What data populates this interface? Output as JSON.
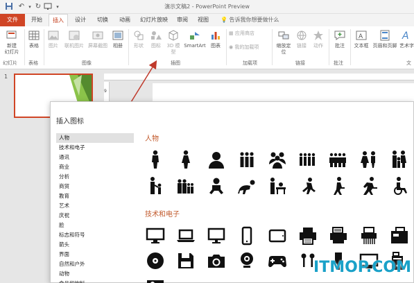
{
  "window": {
    "title": "演示文稿2 - PowerPoint Preview"
  },
  "tabs": [
    {
      "label": "文件"
    },
    {
      "label": "开始"
    },
    {
      "label": "插入"
    },
    {
      "label": "设计"
    },
    {
      "label": "切换"
    },
    {
      "label": "动画"
    },
    {
      "label": "幻灯片放映"
    },
    {
      "label": "审阅"
    },
    {
      "label": "视图"
    }
  ],
  "tell_me": "告诉我你想要做什么",
  "ribbon": {
    "buttons": [
      {
        "label": "新建\n幻灯片"
      },
      {
        "label": "表格"
      },
      {
        "label": "图片"
      },
      {
        "label": "联机图片"
      },
      {
        "label": "屏幕截图"
      },
      {
        "label": "相册"
      },
      {
        "label": "形状"
      },
      {
        "label": "图标"
      },
      {
        "label": "3D 模型"
      },
      {
        "label": "SmartArt"
      },
      {
        "label": "图表"
      },
      {
        "label": "应用商店"
      },
      {
        "label": "我的加载项"
      },
      {
        "label": "缩放定位"
      },
      {
        "label": "链接"
      },
      {
        "label": "动作"
      },
      {
        "label": "批注"
      },
      {
        "label": "文本框"
      },
      {
        "label": "页眉和页脚"
      },
      {
        "label": "艺术字"
      }
    ],
    "groups": [
      {
        "label": "幻灯片"
      },
      {
        "label": "表格"
      },
      {
        "label": "图像"
      },
      {
        "label": "插图"
      },
      {
        "label": "加载项"
      },
      {
        "label": "链接"
      },
      {
        "label": "批注"
      },
      {
        "label": "文"
      }
    ]
  },
  "slides": {
    "current_number": "1"
  },
  "ruler": {
    "vertical_mark": "9"
  },
  "dialog": {
    "title": "插入图标",
    "categories": [
      "人物",
      "技术和电子",
      "通讯",
      "商业",
      "分析",
      "商贸",
      "教育",
      "艺术",
      "庆祝",
      "脸",
      "标志和符号",
      "箭头",
      "界面",
      "自然和户外",
      "动物",
      "食品和饮料"
    ],
    "selected_category": "人物",
    "sections": [
      {
        "title": "人物"
      },
      {
        "title": "技术和电子"
      }
    ]
  },
  "watermark": "ITMOP.COM",
  "colors": {
    "accent": "#d04525",
    "section_heading": "#c25a2c",
    "arrow": "#c0392b",
    "slide_green": "#7cb342"
  }
}
